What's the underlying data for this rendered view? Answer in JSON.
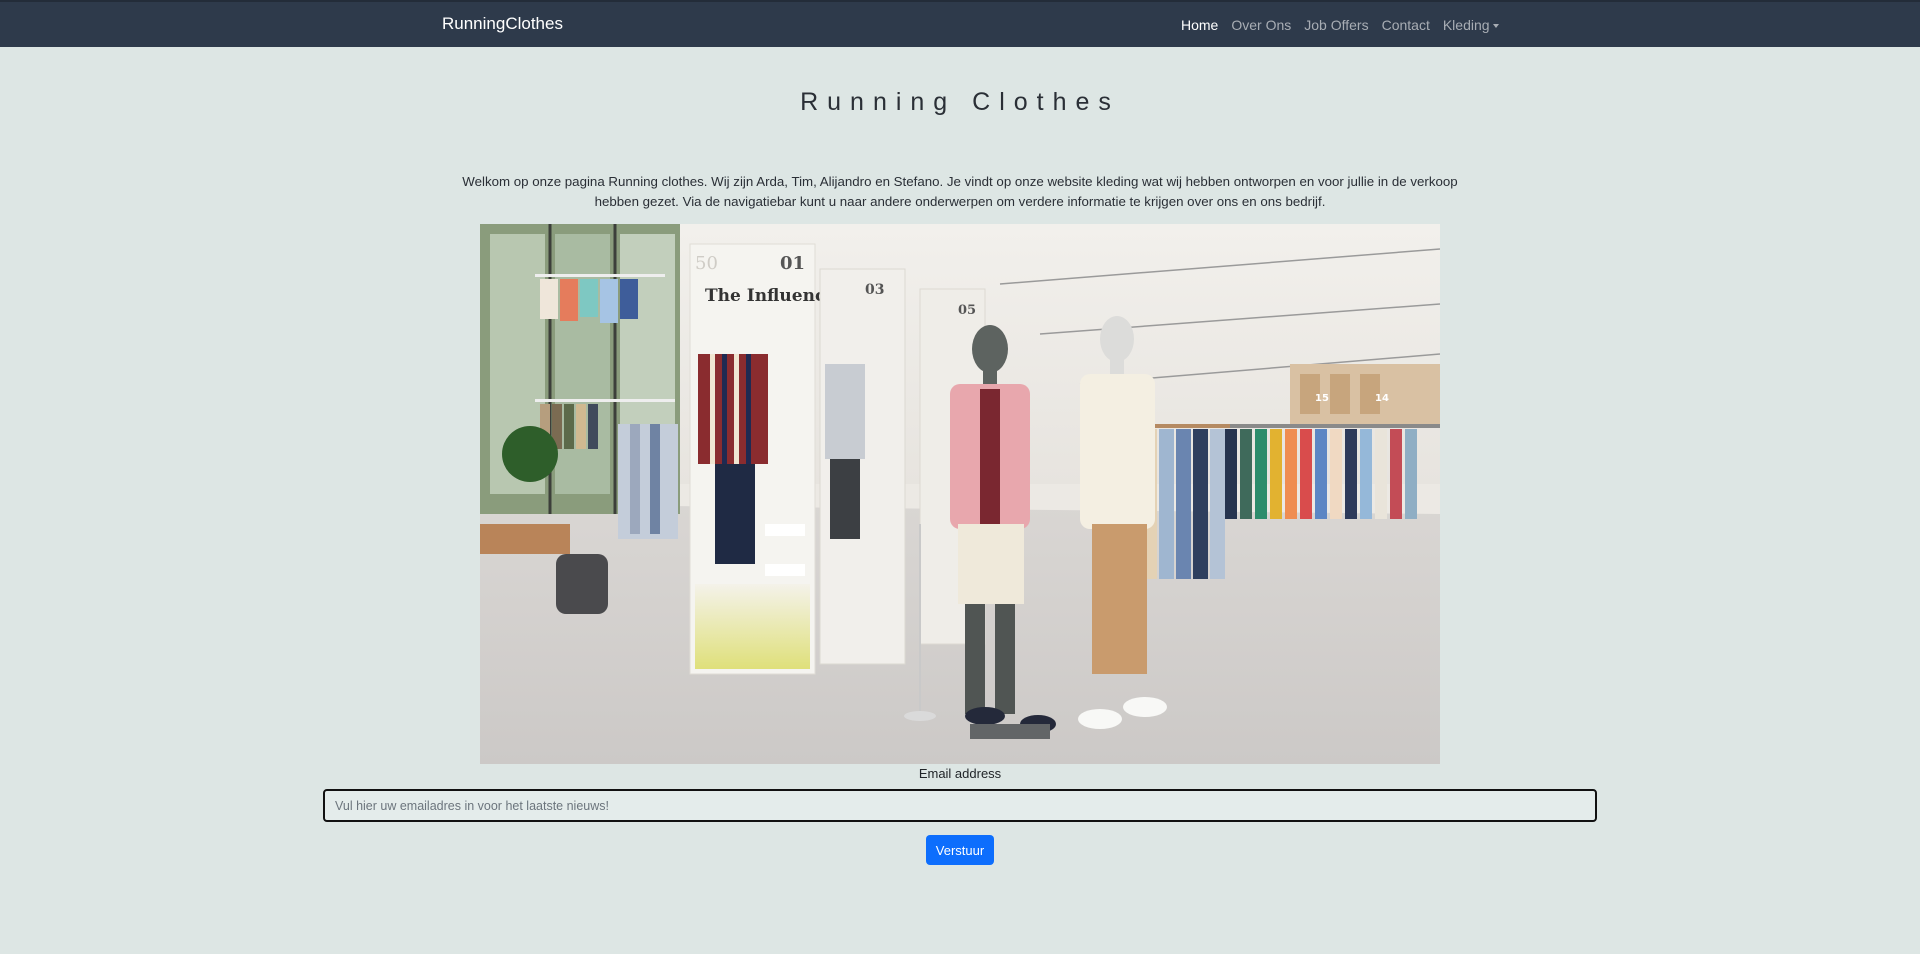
{
  "navbar": {
    "brand": "RunningClothes",
    "links": [
      {
        "label": "Home",
        "active": true
      },
      {
        "label": "Over Ons",
        "active": false
      },
      {
        "label": "Job Offers",
        "active": false
      },
      {
        "label": "Contact",
        "active": false
      },
      {
        "label": "Kleding",
        "active": false,
        "dropdown": true
      }
    ]
  },
  "main": {
    "title": "Running Clothes",
    "intro": "Welkom op onze pagina Running clothes. Wij zijn Arda, Tim, Alijandro en Stefano. Je vindt op onze website kleding wat wij hebben ontworpen en voor jullie in de verkoop hebben gezet. Via de navigatiebar kunt u naar andere onderwerpen om verdere informatie te krijgen over ons en ons bedrijf.",
    "hero_image": {
      "panel_numbers": [
        "50",
        "01",
        "03",
        "05"
      ],
      "sign_text": "The Influencers",
      "aisle_numbers": [
        "15",
        "14"
      ]
    }
  },
  "form": {
    "email_label": "Email address",
    "email_placeholder": "Vul hier uw emailadres in voor het laatste nieuws!",
    "submit_label": "Verstuur"
  },
  "colors": {
    "navbar_bg": "#2e3a4b",
    "page_bg": "#dde6e4",
    "button_primary": "#0d6efd"
  }
}
